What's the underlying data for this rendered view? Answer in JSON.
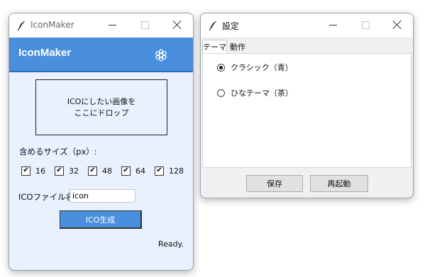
{
  "main_window": {
    "title": "IconMaker",
    "app_title": "IconMaker",
    "dropzone_lines": [
      "ICOにしたい画像を",
      "ここにドロップ"
    ],
    "sizes_label": "含めるサイズ（px）:",
    "sizes": [
      {
        "label": "16",
        "checked": true
      },
      {
        "label": "32",
        "checked": true
      },
      {
        "label": "48",
        "checked": true
      },
      {
        "label": "64",
        "checked": true
      },
      {
        "label": "128",
        "checked": true
      }
    ],
    "filename_label": "ICOファイル名",
    "filename_value": "icon",
    "generate_label": "ICO生成",
    "status": "Ready.",
    "colors": {
      "accent": "#4a8fdd",
      "background": "#e8f1fd"
    }
  },
  "settings_window": {
    "title": "設定",
    "tabs": [
      {
        "label": "テーマ",
        "active": true
      },
      {
        "label": "動作",
        "active": false
      }
    ],
    "theme_options": [
      {
        "label": "クラシック（青）",
        "selected": true
      },
      {
        "label": "ひなテーマ（茶）",
        "selected": false
      }
    ],
    "save_label": "保存",
    "restart_label": "再起動"
  },
  "icons": {
    "app": "feather-icon",
    "settings": "gear-icon",
    "minimize": "minimize-icon",
    "maximize": "maximize-icon",
    "close": "close-icon"
  }
}
